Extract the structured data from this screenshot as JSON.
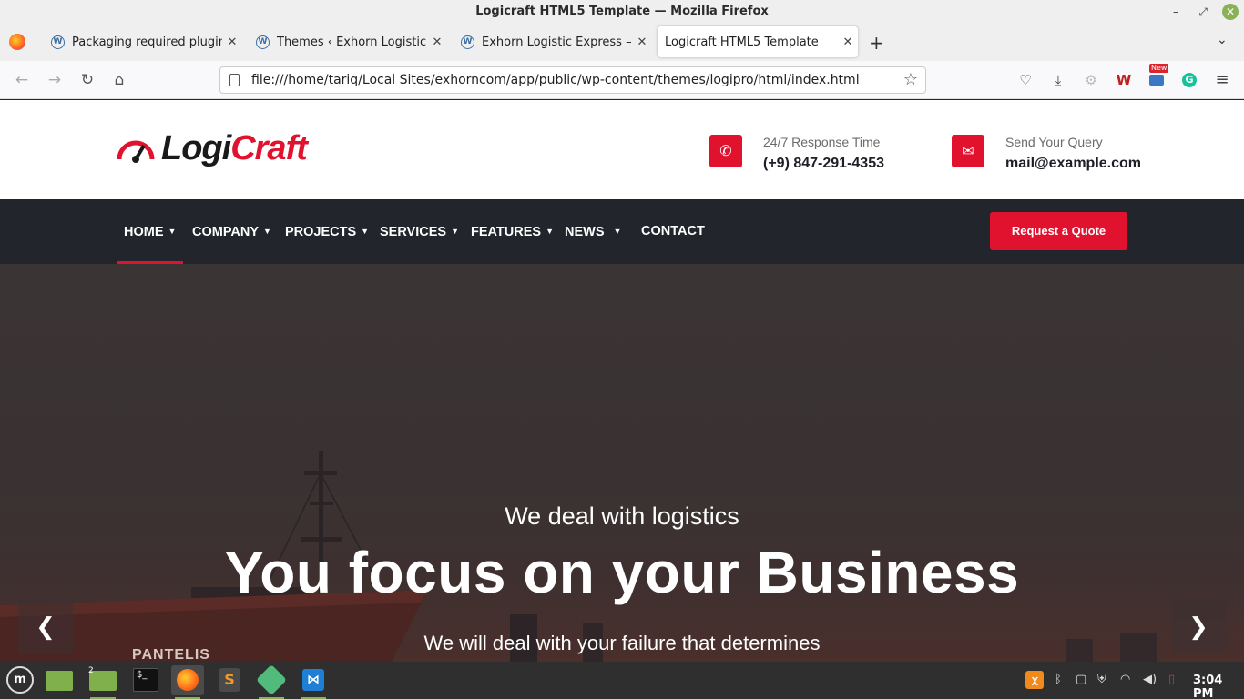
{
  "window": {
    "title": "Logicraft HTML5 Template — Mozilla Firefox",
    "minimize": "–",
    "maximize": "⤢",
    "close": "✕"
  },
  "tabs": [
    {
      "label": "Packaging required plugins",
      "icon": "wordpress-icon"
    },
    {
      "label": "Themes ‹ Exhorn Logistic Ex",
      "icon": "wordpress-icon"
    },
    {
      "label": "Exhorn Logistic Express – Be",
      "icon": "wordpress-icon"
    },
    {
      "label": "Logicraft HTML5 Template",
      "icon": "none",
      "active": true
    }
  ],
  "browser": {
    "url": "file:///home/tariq/Local Sites/exhorncom/app/public/wp-content/themes/logipro/html/index.html",
    "extension_badge": "New"
  },
  "site": {
    "logo": {
      "part1": "Logi",
      "part2": "Craft"
    },
    "contacts": [
      {
        "label": "24/7 Response Time",
        "value": "(+9) 847-291-4353",
        "icon": "phone-icon"
      },
      {
        "label": "Send Your Query",
        "value": "mail@example.com",
        "icon": "envelope-icon"
      }
    ],
    "menu": [
      {
        "label": "HOME",
        "dropdown": true,
        "active": true
      },
      {
        "label": "COMPANY",
        "dropdown": true
      },
      {
        "label": "PROJECTS",
        "dropdown": true
      },
      {
        "label": "SERVICES",
        "dropdown": true
      },
      {
        "label": "FEATURES",
        "dropdown": true
      },
      {
        "label": "NEWS",
        "dropdown": true
      },
      {
        "label": "CONTACT",
        "dropdown": false
      }
    ],
    "quote_button": "Request a Quote",
    "hero": {
      "kicker": "We deal with logistics",
      "title": "You focus on your Business",
      "subtitle": "We will deal with your failure that determines",
      "ship_name": "PANTELIS"
    },
    "colors": {
      "accent": "#e0122e",
      "nav_bg": "#22252b"
    }
  },
  "taskbar": {
    "files_badge": "2",
    "clock": "3:04 PM"
  }
}
